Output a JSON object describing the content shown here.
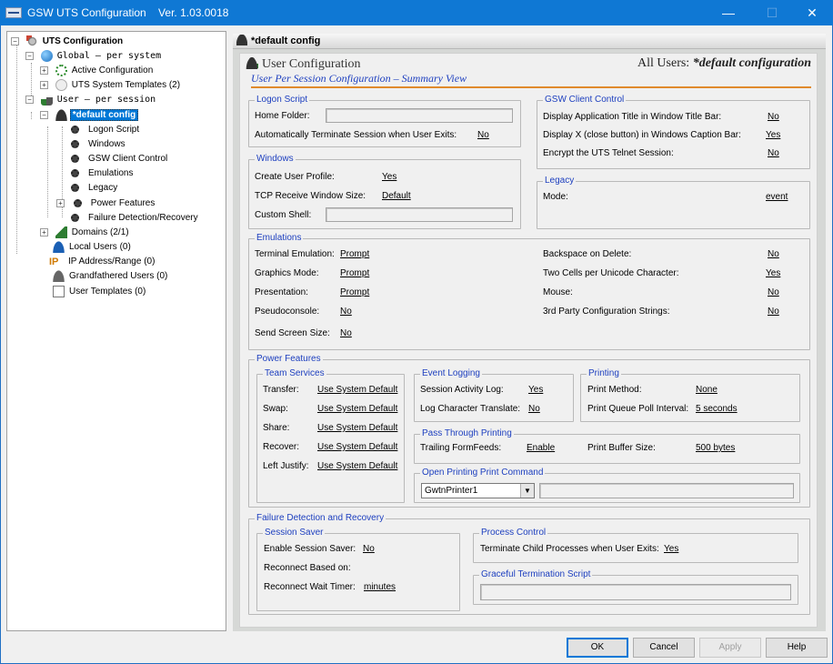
{
  "window": {
    "title": "GSW UTS Configuration    Ver. 1.03.0018",
    "minimize": "—",
    "maximize": "☐",
    "close": "✕"
  },
  "tree": {
    "root": "UTS Configuration",
    "global": "Global  – per system",
    "active_configuration": "Active Configuration",
    "uts_system_templates": "UTS System Templates (2)",
    "user": "User    – per session",
    "default_config": "*default config",
    "children": [
      "Logon Script",
      "Windows",
      "GSW Client Control",
      "Emulations",
      "Legacy",
      "Power Features",
      "Failure Detection/Recovery"
    ],
    "domains": "Domains (2/1)",
    "local_users": "Local Users (0)",
    "ip_address_range": "IP Address/Range (0)",
    "grandfathered_users": "Grandfathered Users (0)",
    "user_templates": "User Templates (0)",
    "ip_icon_text": "IP"
  },
  "header": {
    "title": "*default config",
    "section_title": "User Configuration",
    "all_users_label": "All Users:",
    "all_users_value": "*default configuration",
    "subtitle": "User Per Session Configuration – Summary View"
  },
  "logon_script": {
    "legend": "Logon Script",
    "home_folder_label": "Home Folder:",
    "auto_terminate_label": "Automatically Terminate Session when User Exits:",
    "auto_terminate_value": "No"
  },
  "gsw_client_control": {
    "legend": "GSW Client Control",
    "display_app_title_label": "Display Application Title in Window Title Bar:",
    "display_app_title_value": "No",
    "display_x_label": "Display X (close button) in Windows Caption Bar:",
    "display_x_value": "Yes",
    "encrypt_label": "Encrypt the UTS Telnet Session:",
    "encrypt_value": "No"
  },
  "windows": {
    "legend": "Windows",
    "create_profile_label": "Create User Profile:",
    "create_profile_value": "Yes",
    "tcp_window_label": "TCP Receive Window Size:",
    "tcp_window_value": "Default",
    "custom_shell_label": "Custom Shell:"
  },
  "legacy": {
    "legend": "Legacy",
    "mode_label": "Mode:",
    "mode_value": "event"
  },
  "emulations": {
    "legend": "Emulations",
    "terminal_emulation_label": "Terminal Emulation:",
    "terminal_emulation_value": "Prompt",
    "graphics_mode_label": "Graphics Mode:",
    "graphics_mode_value": "Prompt",
    "presentation_label": "Presentation:",
    "presentation_value": "Prompt",
    "pseudoconsole_label": "Pseudoconsole:",
    "pseudoconsole_value": "No",
    "send_screen_size_label": "Send Screen Size:",
    "send_screen_size_value": "No",
    "backspace_label": "Backspace on Delete:",
    "backspace_value": "No",
    "two_cells_label": "Two Cells per Unicode Character:",
    "two_cells_value": "Yes",
    "mouse_label": "Mouse:",
    "mouse_value": "No",
    "third_party_label": "3rd Party Configuration Strings:",
    "third_party_value": "No"
  },
  "power_features": {
    "legend": "Power Features",
    "team_services": {
      "legend": "Team Services",
      "transfer_label": "Transfer:",
      "transfer_value": "Use System Default",
      "swap_label": "Swap:",
      "swap_value": "Use System Default",
      "share_label": "Share:",
      "share_value": "Use System Default",
      "recover_label": "Recover:",
      "recover_value": "Use System Default",
      "left_justify_label": "Left Justify:",
      "left_justify_value": "Use System Default"
    },
    "event_logging": {
      "legend": "Event Logging",
      "activity_log_label": "Session Activity Log:",
      "activity_log_value": "Yes",
      "char_translate_label": "Log Character Translate:",
      "char_translate_value": "No"
    },
    "printing": {
      "legend": "Printing",
      "print_method_label": "Print Method:",
      "print_method_value": "None",
      "poll_interval_label": "Print Queue Poll Interval:",
      "poll_interval_value": "5 seconds"
    },
    "pass_through": {
      "legend": "Pass Through Printing",
      "trailing_ff_label": "Trailing FormFeeds:",
      "trailing_ff_value": "Enable",
      "buffer_size_label": "Print Buffer Size:",
      "buffer_size_value": "500 bytes"
    },
    "open_printing": {
      "legend": "Open Printing Print Command",
      "printer_selected": "GwtnPrinter1"
    }
  },
  "failure_detection": {
    "legend": "Failure Detection and Recovery",
    "session_saver": {
      "legend": "Session Saver",
      "enable_label": "Enable Session Saver:",
      "enable_value": "No",
      "reconnect_based_label": "Reconnect Based on:",
      "reconnect_wait_label": "Reconnect Wait Timer:",
      "reconnect_wait_value": "minutes"
    },
    "process_control": {
      "legend": "Process Control",
      "terminate_child_label": "Terminate Child Processes when User Exits:",
      "terminate_child_value": "Yes"
    },
    "graceful_termination": {
      "legend": "Graceful Termination Script"
    }
  },
  "buttons": {
    "ok": "OK",
    "cancel": "Cancel",
    "apply": "Apply",
    "help": "Help"
  }
}
